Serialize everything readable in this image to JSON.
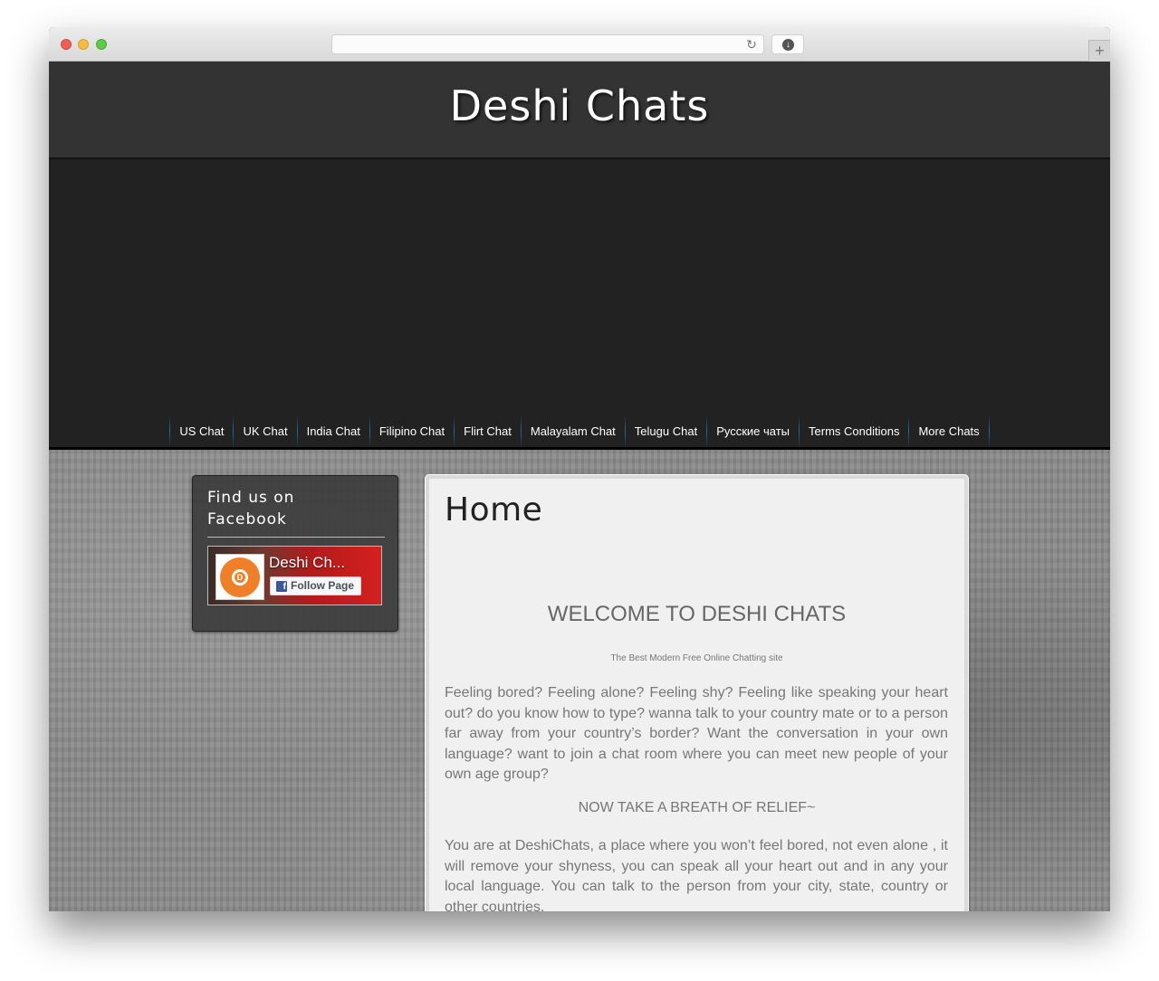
{
  "browser": {
    "address_bar": {
      "value": "",
      "placeholder": ""
    },
    "reload_icon": "reload-icon",
    "download_icon": "download-icon",
    "new_tab_label": "+"
  },
  "site": {
    "title": "Deshi Chats",
    "nav": [
      {
        "label": "US Chat"
      },
      {
        "label": "UK Chat"
      },
      {
        "label": "India Chat"
      },
      {
        "label": "Filipino Chat"
      },
      {
        "label": "Flirt Chat"
      },
      {
        "label": "Malayalam Chat"
      },
      {
        "label": "Telugu Chat"
      },
      {
        "label": "Русские чаты"
      },
      {
        "label": "Terms Conditions"
      },
      {
        "label": "More Chats"
      }
    ]
  },
  "sidebar": {
    "widget_title_line1": "Find us on",
    "widget_title_line2": "Facebook",
    "facebook": {
      "page_name": "Deshi Ch...",
      "logo_letter": "D",
      "follow_label": "Follow Page",
      "f_glyph": "f"
    }
  },
  "main": {
    "page_title": "Home",
    "welcome_heading": "WELCOME TO DESHI CHATS",
    "tagline": "The Best Modern Free Online Chatting site",
    "paragraph_1": "Feeling bored? Feeling alone? Feeling shy? Feeling like speaking your heart out? do you know how to type? wanna talk to your country mate or to a person far away from your country’s border? Want the conversation in your own language? want to join a chat room where you can meet new people of your own age group?",
    "relief_line": "NOW TAKE A BREATH OF RELIEF~",
    "paragraph_2": "You are at DeshiChats, a place where you won’t feel bored, not even alone , it will remove your shyness, you can speak all your heart out and in any your local language. You can talk to the person from your city, state, country or other countries."
  },
  "colors": {
    "header_bg": "#333333",
    "banner_bg": "#222222",
    "nav_separator": "#1e6fa8",
    "content_bg": "#f0f0f0",
    "body_text": "#777777",
    "fb_orange": "#f07f2a",
    "fb_blue": "#3b5998"
  }
}
